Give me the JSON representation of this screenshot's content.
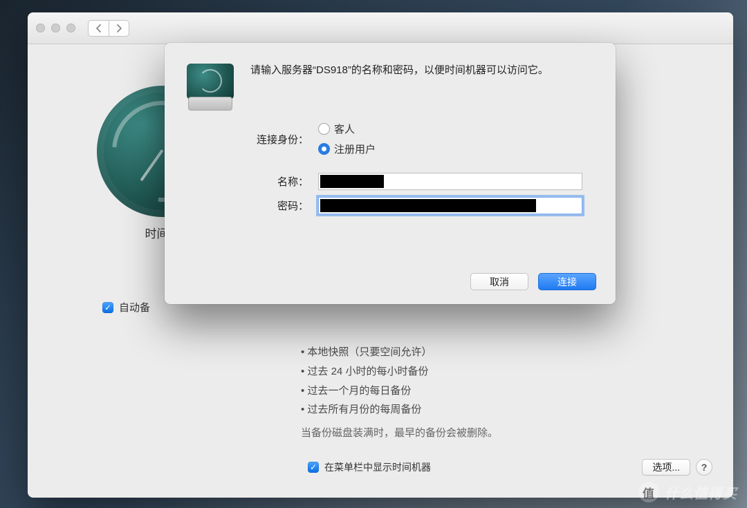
{
  "prefs": {
    "tm_title": "时间机",
    "auto_backup_label": "自动备",
    "info": {
      "i1": "本地快照（只要空间允许）",
      "i2": "过去 24 小时的每小时备份",
      "i3": "过去一个月的每日备份",
      "i4": "过去所有月份的每周备份",
      "note": "当备份磁盘装满时，最早的备份会被删除。"
    },
    "show_in_menubar": "在菜单栏中显示时间机器",
    "options_button": "选项...",
    "help": "?"
  },
  "dialog": {
    "message": "请输入服务器“DS918”的名称和密码，以便时间机器可以访问它。",
    "connect_as_label": "连接身份：",
    "guest_label": "客人",
    "registered_label": "注册用户",
    "name_label": "名称：",
    "password_label": "密码：",
    "name_value": "",
    "password_value": "",
    "cancel": "取消",
    "connect": "连接"
  },
  "watermark": {
    "text": "什么值得买",
    "badge": "值"
  }
}
